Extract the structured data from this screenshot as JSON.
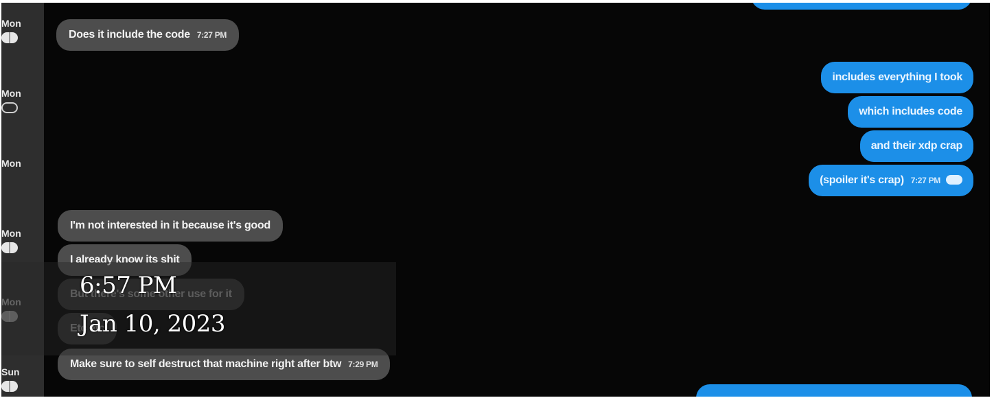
{
  "sidebar": {
    "entries": [
      {
        "day": "Mon",
        "icon": "toggle-icon"
      },
      {
        "day": "Mon",
        "icon": "checkmark-icon"
      },
      {
        "day": "Mon",
        "icon": "none"
      },
      {
        "day": "Mon",
        "icon": "toggle-icon"
      },
      {
        "day": "Mon",
        "icon": "toggle-icon"
      },
      {
        "day": "Sun",
        "icon": "toggle-icon"
      }
    ]
  },
  "messages": {
    "m1": {
      "text": "Does it include the code",
      "time": "7:27 PM"
    },
    "m2": {
      "text": "includes everything I took"
    },
    "m3": {
      "text": "which includes code"
    },
    "m4": {
      "text": "and their xdp crap"
    },
    "m5": {
      "text": "(spoiler it's crap)",
      "time": "7:27 PM"
    },
    "m6": {
      "text": "I'm not interested in it because it's good"
    },
    "m7": {
      "text": "I already know its shit"
    },
    "m8": {
      "text": "But there's some other use for it"
    },
    "m9": {
      "text": "Etc etc"
    },
    "m10": {
      "text": "Make sure to self destruct that machine right after btw",
      "time": "7:29 PM"
    }
  },
  "overlay": {
    "time": "6:57 PM",
    "date": "Jan 10, 2023"
  },
  "colors": {
    "background": "#060606",
    "sidebar": "#2e2e2e",
    "incoming_bubble": "#4d4d4d",
    "outgoing_bubble": "#1c8fe8"
  }
}
